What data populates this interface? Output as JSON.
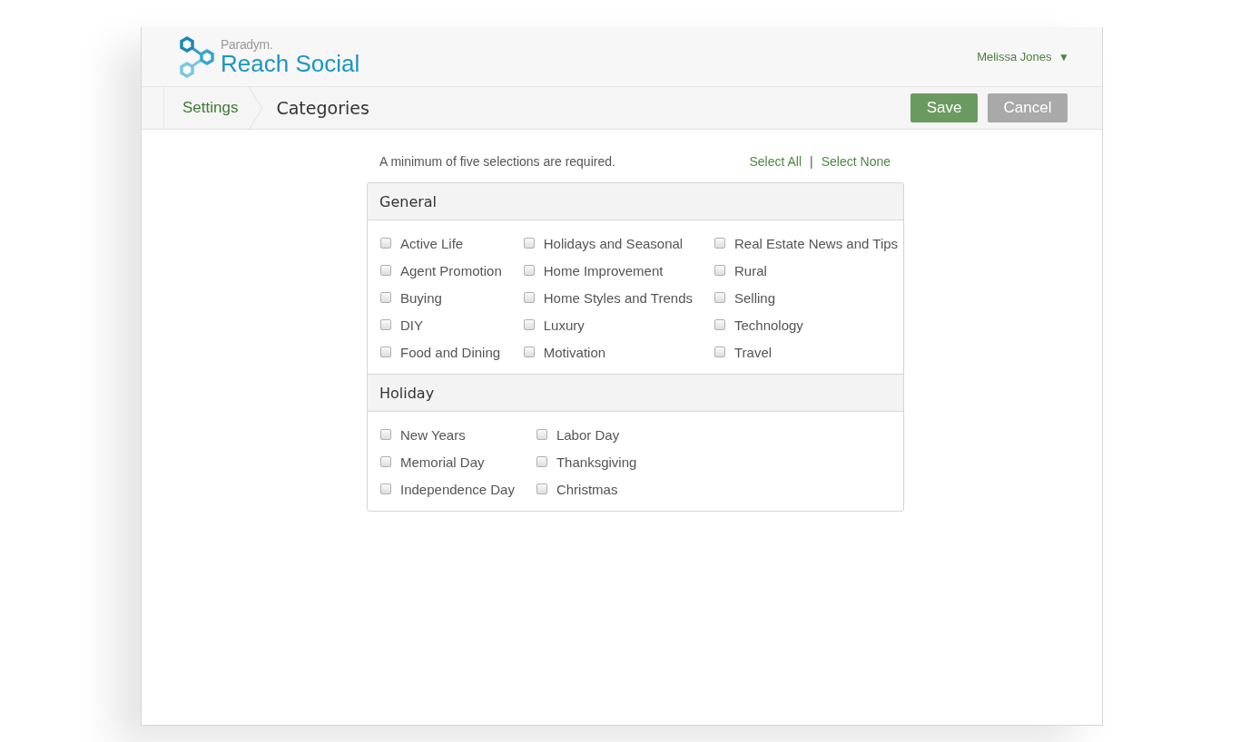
{
  "header": {
    "brand_small": "Paradym.",
    "brand_name": "Reach Social",
    "user": {
      "name": "Melissa Jones",
      "caret": "▼"
    }
  },
  "toolbar": {
    "breadcrumb": [
      {
        "label": "Settings",
        "kind": "link"
      },
      {
        "label": "Categories",
        "kind": "current"
      }
    ],
    "buttons": [
      {
        "label": "Save",
        "kind": "primary"
      },
      {
        "label": "Cancel",
        "kind": "secondary"
      }
    ]
  },
  "notice": "A minimum of five selections are required.",
  "select_links": {
    "all": "Select All",
    "separator": "|",
    "none": "Select None"
  },
  "sections": [
    {
      "title": "General",
      "columns": [
        [
          {
            "label": "Active Life",
            "checked": false
          },
          {
            "label": "Agent Promotion",
            "checked": false
          },
          {
            "label": "Buying",
            "checked": false
          },
          {
            "label": "DIY",
            "checked": false
          },
          {
            "label": "Food and Dining",
            "checked": false
          }
        ],
        [
          {
            "label": "Holidays and Seasonal",
            "checked": false
          },
          {
            "label": "Home Improvement",
            "checked": false
          },
          {
            "label": "Home Styles and Trends",
            "checked": false
          },
          {
            "label": "Luxury",
            "checked": false
          },
          {
            "label": "Motivation",
            "checked": false
          }
        ],
        [
          {
            "label": "Real Estate News and Tips",
            "checked": false
          },
          {
            "label": "Rural",
            "checked": false
          },
          {
            "label": "Selling",
            "checked": false
          },
          {
            "label": "Technology",
            "checked": false
          },
          {
            "label": "Travel",
            "checked": false
          }
        ]
      ]
    },
    {
      "title": "Holiday",
      "columns": [
        [
          {
            "label": "New Years",
            "checked": false
          },
          {
            "label": "Memorial Day",
            "checked": false
          },
          {
            "label": "Independence Day",
            "checked": false
          }
        ],
        [
          {
            "label": "Labor Day",
            "checked": false
          },
          {
            "label": "Thanksgiving",
            "checked": false
          },
          {
            "label": "Christmas",
            "checked": false
          }
        ]
      ]
    }
  ]
}
